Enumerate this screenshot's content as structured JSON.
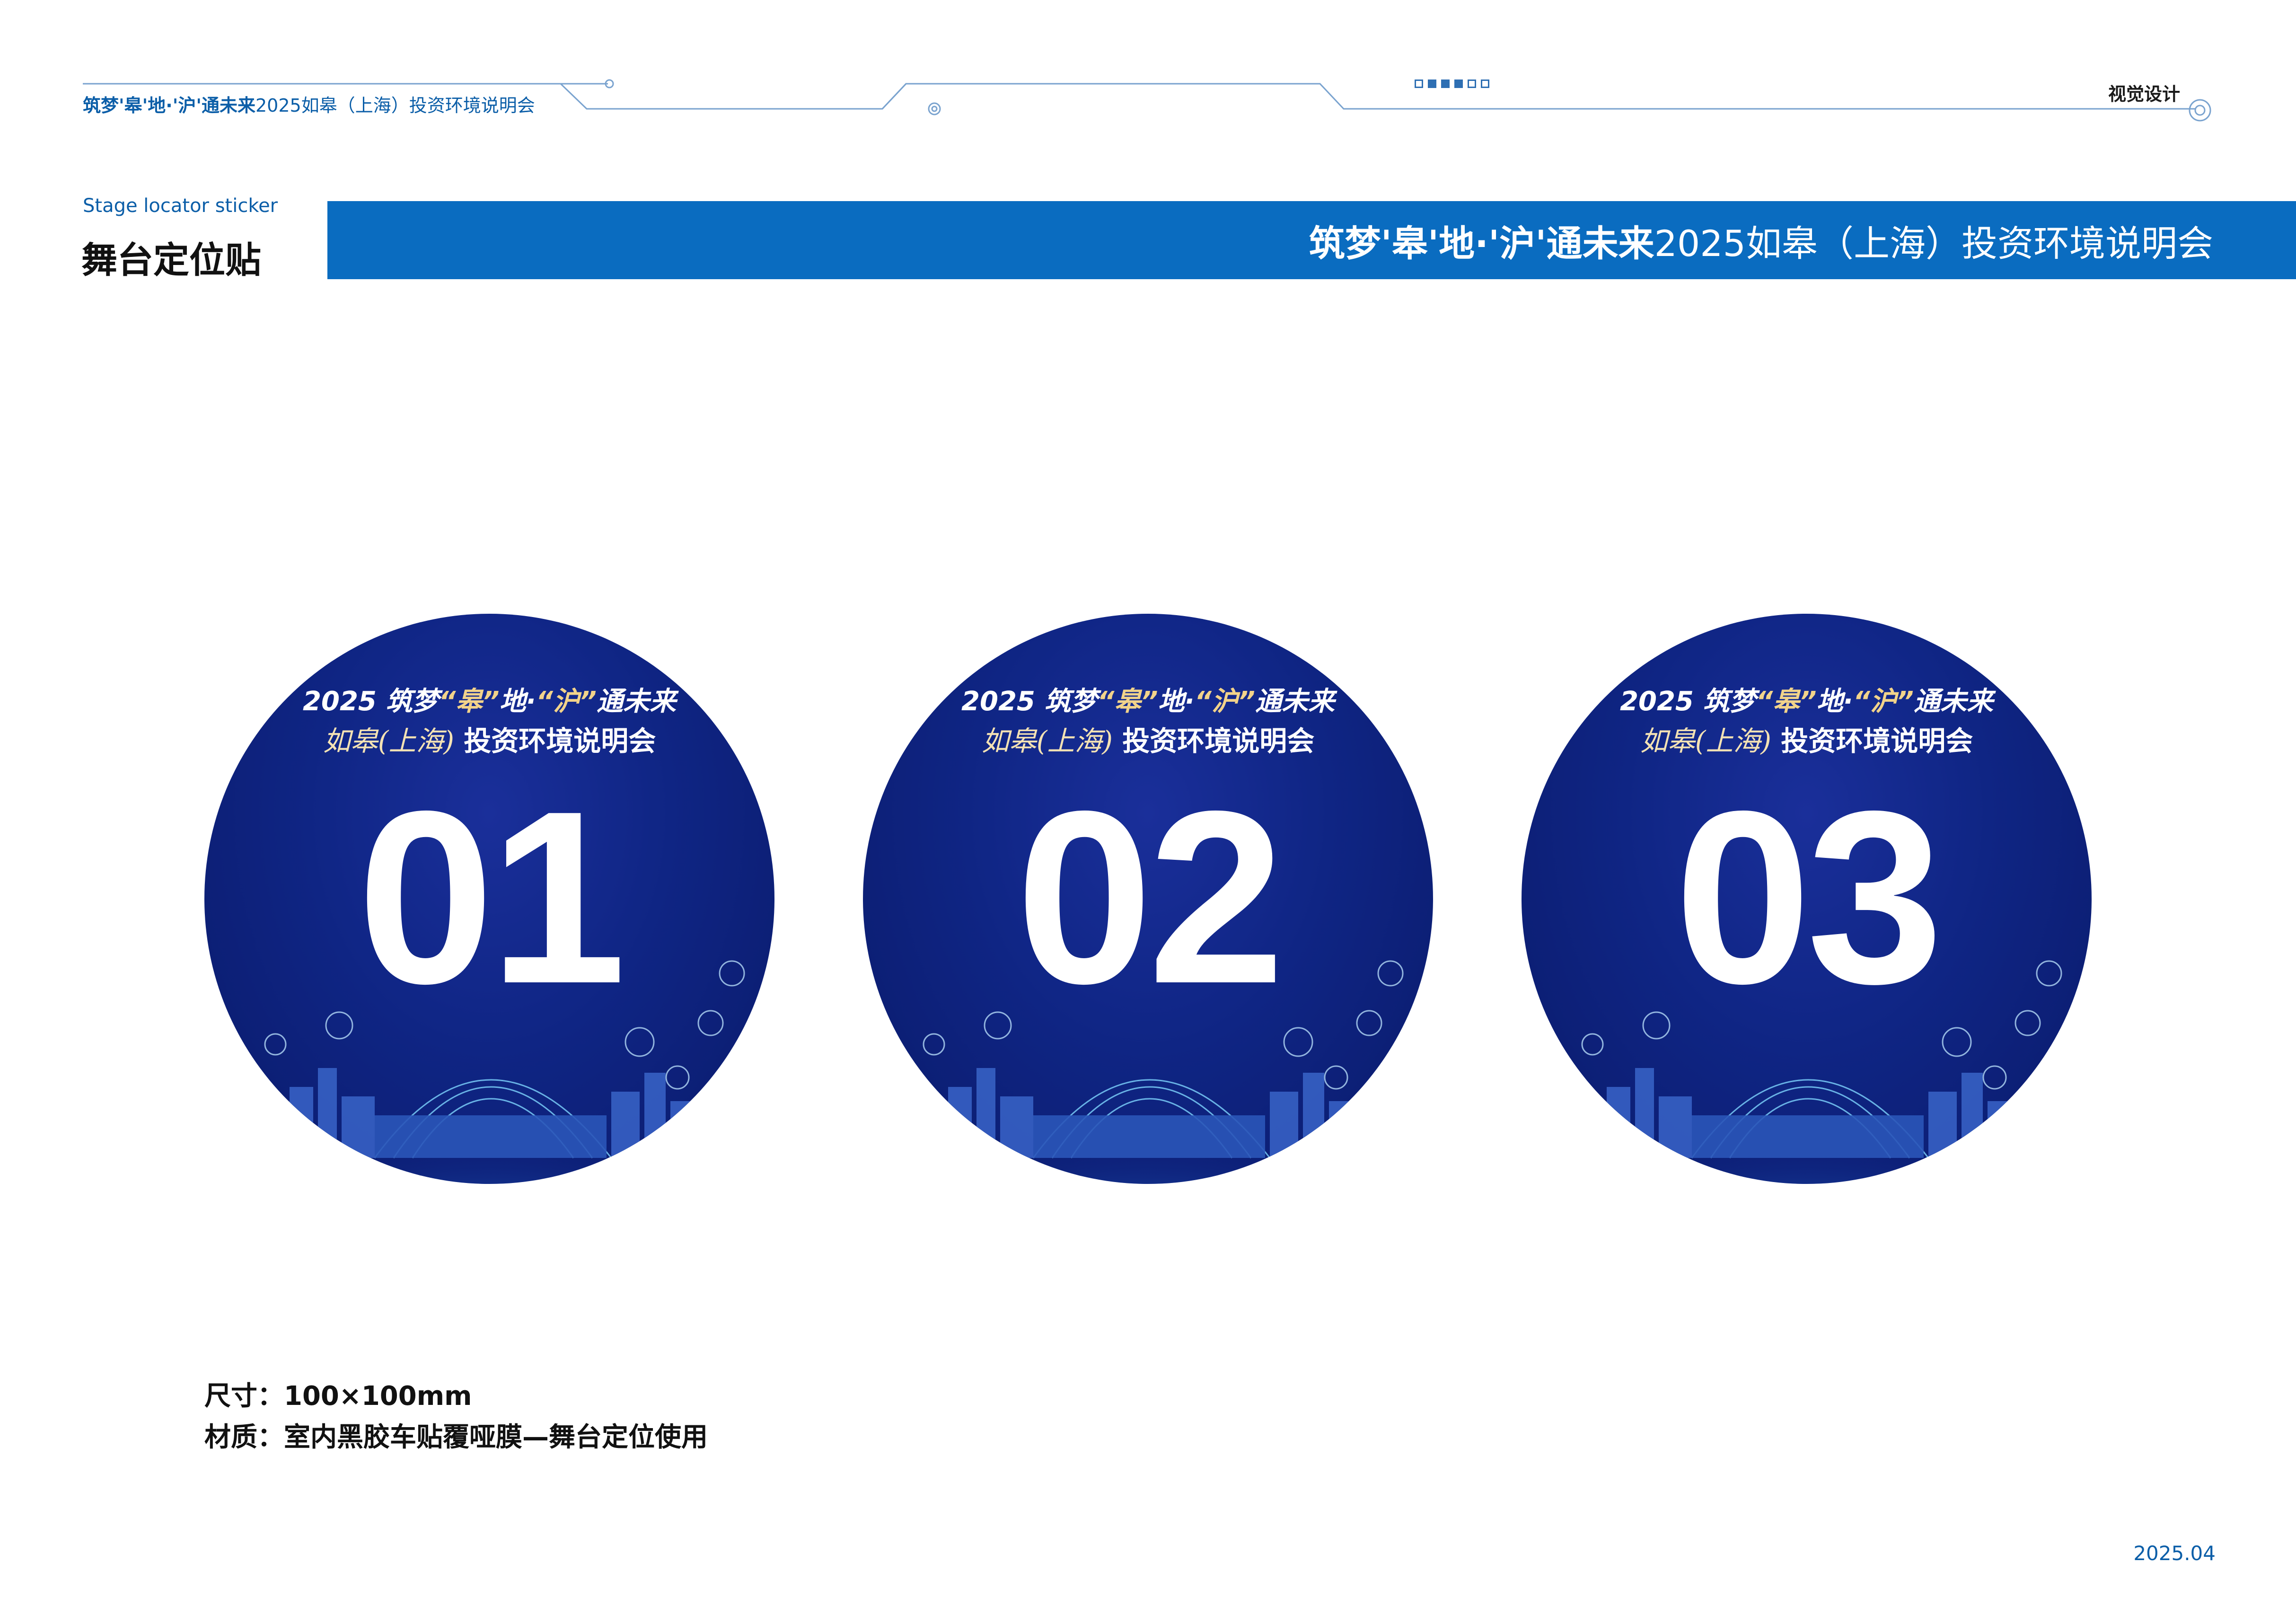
{
  "header": {
    "title_bold": "筑梦'皋'地·'沪'通未来",
    "title_rest": "2025如皋（上海）投资环境说明会",
    "right_label": "视觉设计"
  },
  "section": {
    "subtitle_en": "Stage locator sticker",
    "subtitle_cn": "舞台定位贴"
  },
  "banner": {
    "title_bold": "筑梦'皋'地·'沪'通未来",
    "title_rest": "2025如皋（上海）投资环境说明会"
  },
  "sticker_text": {
    "year": "2025 筑梦",
    "q1": "“皋”",
    "mid": "地·",
    "q2": "“沪”",
    "tail": "通未来",
    "script": "如皋(上海)",
    "event": "投资环境说明会"
  },
  "stickers": [
    {
      "number": "01"
    },
    {
      "number": "02"
    },
    {
      "number": "03"
    }
  ],
  "spec": {
    "size": "尺寸：100×100mm",
    "material": "材质：室内黑胶车贴覆哑膜—舞台定位使用"
  },
  "footer": {
    "date": "2025.04"
  },
  "colors": {
    "brand_blue": "#0a6cc0",
    "sticker_navy": "#0f2584",
    "accent_gold": "#f2d38a"
  }
}
